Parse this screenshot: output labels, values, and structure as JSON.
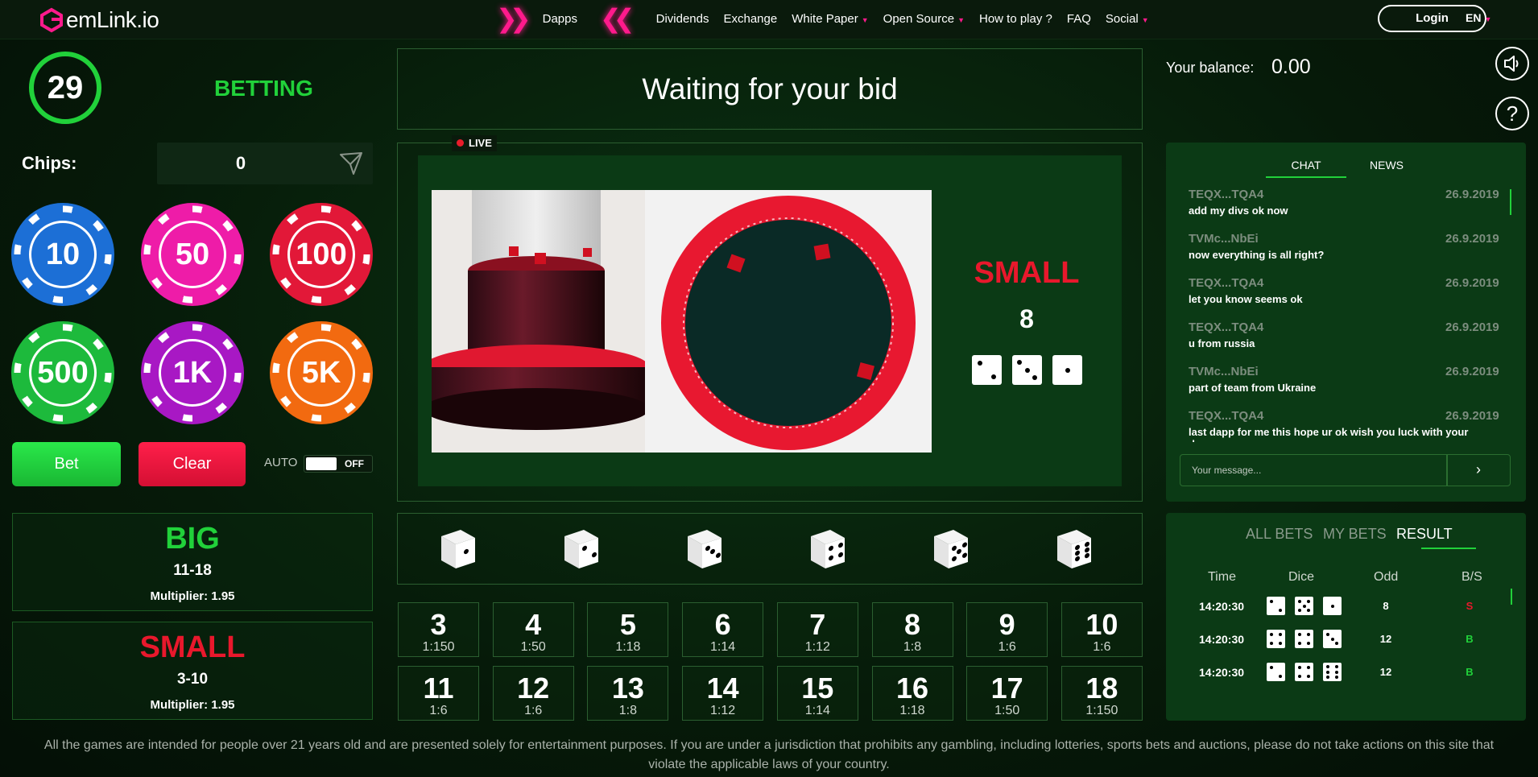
{
  "header": {
    "logo_text": "emLink.io",
    "nav": [
      {
        "label": "Dapps",
        "caret": false
      },
      {
        "label": "Dividends",
        "caret": false
      },
      {
        "label": "Exchange",
        "caret": false
      },
      {
        "label": "White Paper",
        "caret": true
      },
      {
        "label": "Open Source",
        "caret": true
      },
      {
        "label": "How to play ?",
        "caret": false
      },
      {
        "label": "FAQ",
        "caret": false
      },
      {
        "label": "Social",
        "caret": true
      }
    ],
    "login_label": "Login",
    "language": "EN"
  },
  "game": {
    "timer": "29",
    "status": "BETTING",
    "chips_label": "Chips:",
    "chips_value": "0",
    "chips": [
      {
        "label": "10",
        "color": "#1c6fd6"
      },
      {
        "label": "50",
        "color": "#ee1ca8"
      },
      {
        "label": "100",
        "color": "#e21838"
      },
      {
        "label": "500",
        "color": "#1dba3c"
      },
      {
        "label": "1K",
        "color": "#a818c4"
      },
      {
        "label": "5K",
        "color": "#f26a10"
      }
    ],
    "bet_label": "Bet",
    "clear_label": "Clear",
    "auto_label": "AUTO",
    "auto_state": "OFF",
    "big": {
      "title": "BIG",
      "range": "11-18",
      "multiplier": "Multiplier: 1.95",
      "color": "#21d13a"
    },
    "small": {
      "title": "SMALL",
      "range": "3-10",
      "multiplier": "Multiplier: 1.95",
      "color": "#e8182c"
    }
  },
  "stage": {
    "wait_text": "Waiting for your bid",
    "live_label": "LIVE",
    "result_label": "SMALL",
    "result_sum": "8",
    "result_dice": [
      2,
      3,
      1
    ]
  },
  "single_dice": [
    1,
    2,
    3,
    4,
    5,
    6
  ],
  "numbers": [
    {
      "n": "3",
      "odd": "1:150"
    },
    {
      "n": "4",
      "odd": "1:50"
    },
    {
      "n": "5",
      "odd": "1:18"
    },
    {
      "n": "6",
      "odd": "1:14"
    },
    {
      "n": "7",
      "odd": "1:12"
    },
    {
      "n": "8",
      "odd": "1:8"
    },
    {
      "n": "9",
      "odd": "1:6"
    },
    {
      "n": "10",
      "odd": "1:6"
    },
    {
      "n": "11",
      "odd": "1:6"
    },
    {
      "n": "12",
      "odd": "1:6"
    },
    {
      "n": "13",
      "odd": "1:8"
    },
    {
      "n": "14",
      "odd": "1:12"
    },
    {
      "n": "15",
      "odd": "1:14"
    },
    {
      "n": "16",
      "odd": "1:18"
    },
    {
      "n": "17",
      "odd": "1:50"
    },
    {
      "n": "18",
      "odd": "1:150"
    }
  ],
  "balance": {
    "label": "Your balance:",
    "value": "0.00"
  },
  "chat": {
    "tabs": [
      "CHAT",
      "NEWS"
    ],
    "messages": [
      {
        "user": "TEQX...TQA4",
        "date": "26.9.2019",
        "text": "add my divs ok now"
      },
      {
        "user": "TVMc...NbEi",
        "date": "26.9.2019",
        "text": "now everything is all right?"
      },
      {
        "user": "TEQX...TQA4",
        "date": "26.9.2019",
        "text": "let you know seems ok"
      },
      {
        "user": "TEQX...TQA4",
        "date": "26.9.2019",
        "text": "u from russia"
      },
      {
        "user": "TVMc...NbEi",
        "date": "26.9.2019",
        "text": "part of team from Ukraine"
      },
      {
        "user": "TEQX...TQA4",
        "date": "26.9.2019",
        "text": "last dapp for me this hope ur ok wish you luck with your dapp"
      }
    ],
    "input_placeholder": "Your message...",
    "send_label": "›"
  },
  "bets": {
    "tabs": [
      "ALL BETS",
      "MY BETS",
      "RESULT"
    ],
    "headers": [
      "Time",
      "Dice",
      "Odd",
      "B/S"
    ],
    "rows": [
      {
        "time": "14:20:30",
        "dice": [
          2,
          5,
          1
        ],
        "odd": "8",
        "bs": "S",
        "bs_color": "#e8182c"
      },
      {
        "time": "14:20:30",
        "dice": [
          4,
          4,
          3
        ],
        "odd": "12",
        "bs": "B",
        "bs_color": "#21d13a"
      },
      {
        "time": "14:20:30",
        "dice": [
          2,
          4,
          6
        ],
        "odd": "12",
        "bs": "B",
        "bs_color": "#21d13a"
      }
    ]
  },
  "disclaimer": "All the games are intended for people over 21 years old and are presented solely for entertainment purposes. If you are under a jurisdiction that prohibits any gambling, including lotteries, sports bets and auctions, please do not take actions on this site that violate the applicable laws of your country."
}
